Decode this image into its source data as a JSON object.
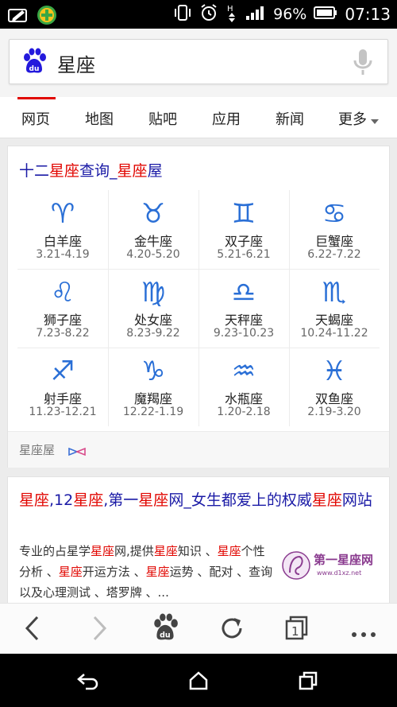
{
  "status_bar": {
    "battery": "96%",
    "time": "07:13"
  },
  "search": {
    "query": "星座"
  },
  "tabs": [
    {
      "label": "网页",
      "active": true
    },
    {
      "label": "地图",
      "active": false
    },
    {
      "label": "贴吧",
      "active": false
    },
    {
      "label": "应用",
      "active": false
    },
    {
      "label": "新闻",
      "active": false
    },
    {
      "label": "更多",
      "active": false
    }
  ],
  "zodiac_card": {
    "title_prefix": "十二",
    "title_hl1": "星座",
    "title_mid": "查询_",
    "title_hl2": "星座",
    "title_suffix": "屋",
    "signs": [
      {
        "glyph": "♈",
        "name": "白羊座",
        "date": "3.21-4.19"
      },
      {
        "glyph": "♉",
        "name": "金牛座",
        "date": "4.20-5.20"
      },
      {
        "glyph": "♊",
        "name": "双子座",
        "date": "5.21-6.21"
      },
      {
        "glyph": "♋",
        "name": "巨蟹座",
        "date": "6.22-7.22"
      },
      {
        "glyph": "♌",
        "name": "狮子座",
        "date": "7.23-8.22"
      },
      {
        "glyph": "♍",
        "name": "处女座",
        "date": "8.23-9.22"
      },
      {
        "glyph": "♎",
        "name": "天秤座",
        "date": "9.23-10.23"
      },
      {
        "glyph": "♏",
        "name": "天蝎座",
        "date": "10.24-11.22"
      },
      {
        "glyph": "♐",
        "name": "射手座",
        "date": "11.23-12.21"
      },
      {
        "glyph": "♑",
        "name": "魔羯座",
        "date": "12.22-1.19"
      },
      {
        "glyph": "♒",
        "name": "水瓶座",
        "date": "1.20-2.18"
      },
      {
        "glyph": "♓",
        "name": "双鱼座",
        "date": "2.19-3.20"
      }
    ],
    "source": "星座屋"
  },
  "result": {
    "title_parts": [
      {
        "t": "星座",
        "hl": true
      },
      {
        "t": ",12",
        "hl": false
      },
      {
        "t": "星座",
        "hl": true
      },
      {
        "t": ",第一",
        "hl": false
      },
      {
        "t": "星座",
        "hl": true
      },
      {
        "t": "网_女生都爱上的权威",
        "hl": false
      },
      {
        "t": "星座",
        "hl": true
      },
      {
        "t": "网站",
        "hl": false
      }
    ],
    "desc_parts": [
      {
        "t": "专业的占星学",
        "hl": false
      },
      {
        "t": "星座",
        "hl": true
      },
      {
        "t": "网,提供",
        "hl": false
      },
      {
        "t": "星座",
        "hl": true
      },
      {
        "t": "知识 、",
        "hl": false
      },
      {
        "t": "星座",
        "hl": true
      },
      {
        "t": "个性分析 、",
        "hl": false
      },
      {
        "t": "星座",
        "hl": true
      },
      {
        "t": "开运方法 、",
        "hl": false
      },
      {
        "t": "星座",
        "hl": true
      },
      {
        "t": "运势 、配对 、查询以及心理测试 、塔罗牌 、...",
        "hl": false
      }
    ],
    "thumb_title": "第一星座网",
    "thumb_url": "www.d1xz.net"
  },
  "colors": {
    "accent_red": "#e10601",
    "link_blue": "#1a1aa6",
    "zodiac_blue": "#2a6fd6",
    "baidu_blue": "#2319dc"
  }
}
